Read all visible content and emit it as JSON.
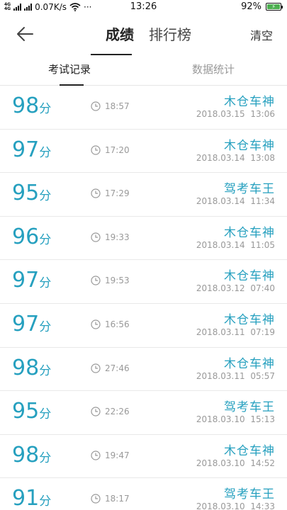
{
  "status": {
    "net_speed": "0.07K/s",
    "dots": "···",
    "time": "13:26",
    "battery": "92%",
    "sig_label_1": "4G",
    "sig_label_2": "4G"
  },
  "header": {
    "tab_scores": "成绩",
    "tab_ranking": "排行榜",
    "clear_label": "清空"
  },
  "subtabs": {
    "records": "考试记录",
    "stats": "数据统计"
  },
  "unit": "分",
  "records": [
    {
      "score": "98",
      "duration": "18:57",
      "player": "木仓车神",
      "date": "2018.03.15  13:06"
    },
    {
      "score": "97",
      "duration": "17:20",
      "player": "木仓车神",
      "date": "2018.03.14  13:08"
    },
    {
      "score": "95",
      "duration": "17:29",
      "player": "驾考车王",
      "date": "2018.03.14  11:34"
    },
    {
      "score": "96",
      "duration": "19:33",
      "player": "木仓车神",
      "date": "2018.03.14  11:05"
    },
    {
      "score": "97",
      "duration": "19:53",
      "player": "木仓车神",
      "date": "2018.03.12  07:40"
    },
    {
      "score": "97",
      "duration": "16:56",
      "player": "木仓车神",
      "date": "2018.03.11  07:19"
    },
    {
      "score": "98",
      "duration": "27:46",
      "player": "木仓车神",
      "date": "2018.03.11  05:57"
    },
    {
      "score": "95",
      "duration": "22:26",
      "player": "驾考车王",
      "date": "2018.03.10  15:13"
    },
    {
      "score": "98",
      "duration": "19:47",
      "player": "木仓车神",
      "date": "2018.03.10  14:52"
    },
    {
      "score": "91",
      "duration": "18:17",
      "player": "驾考车王",
      "date": "2018.03.10  14:33"
    }
  ],
  "colors": {
    "accent": "#26a0bf",
    "muted": "#999999",
    "battery": "#4caf50"
  }
}
